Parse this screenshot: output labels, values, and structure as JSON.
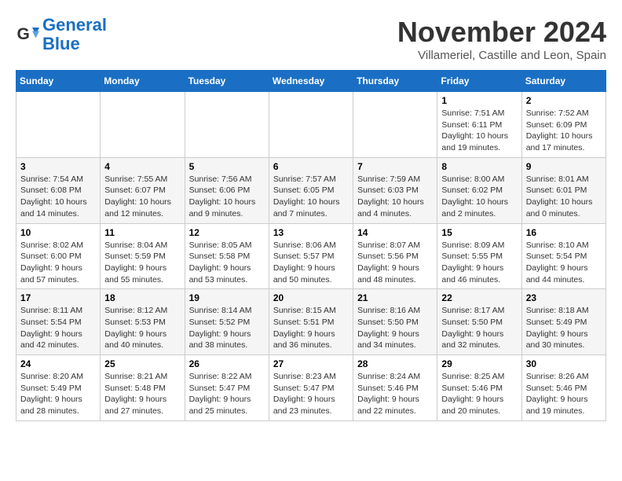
{
  "logo": {
    "line1": "General",
    "line2": "Blue"
  },
  "title": "November 2024",
  "location": "Villameriel, Castille and Leon, Spain",
  "weekdays": [
    "Sunday",
    "Monday",
    "Tuesday",
    "Wednesday",
    "Thursday",
    "Friday",
    "Saturday"
  ],
  "weeks": [
    [
      {
        "day": "",
        "info": ""
      },
      {
        "day": "",
        "info": ""
      },
      {
        "day": "",
        "info": ""
      },
      {
        "day": "",
        "info": ""
      },
      {
        "day": "",
        "info": ""
      },
      {
        "day": "1",
        "info": "Sunrise: 7:51 AM\nSunset: 6:11 PM\nDaylight: 10 hours and 19 minutes."
      },
      {
        "day": "2",
        "info": "Sunrise: 7:52 AM\nSunset: 6:09 PM\nDaylight: 10 hours and 17 minutes."
      }
    ],
    [
      {
        "day": "3",
        "info": "Sunrise: 7:54 AM\nSunset: 6:08 PM\nDaylight: 10 hours and 14 minutes."
      },
      {
        "day": "4",
        "info": "Sunrise: 7:55 AM\nSunset: 6:07 PM\nDaylight: 10 hours and 12 minutes."
      },
      {
        "day": "5",
        "info": "Sunrise: 7:56 AM\nSunset: 6:06 PM\nDaylight: 10 hours and 9 minutes."
      },
      {
        "day": "6",
        "info": "Sunrise: 7:57 AM\nSunset: 6:05 PM\nDaylight: 10 hours and 7 minutes."
      },
      {
        "day": "7",
        "info": "Sunrise: 7:59 AM\nSunset: 6:03 PM\nDaylight: 10 hours and 4 minutes."
      },
      {
        "day": "8",
        "info": "Sunrise: 8:00 AM\nSunset: 6:02 PM\nDaylight: 10 hours and 2 minutes."
      },
      {
        "day": "9",
        "info": "Sunrise: 8:01 AM\nSunset: 6:01 PM\nDaylight: 10 hours and 0 minutes."
      }
    ],
    [
      {
        "day": "10",
        "info": "Sunrise: 8:02 AM\nSunset: 6:00 PM\nDaylight: 9 hours and 57 minutes."
      },
      {
        "day": "11",
        "info": "Sunrise: 8:04 AM\nSunset: 5:59 PM\nDaylight: 9 hours and 55 minutes."
      },
      {
        "day": "12",
        "info": "Sunrise: 8:05 AM\nSunset: 5:58 PM\nDaylight: 9 hours and 53 minutes."
      },
      {
        "day": "13",
        "info": "Sunrise: 8:06 AM\nSunset: 5:57 PM\nDaylight: 9 hours and 50 minutes."
      },
      {
        "day": "14",
        "info": "Sunrise: 8:07 AM\nSunset: 5:56 PM\nDaylight: 9 hours and 48 minutes."
      },
      {
        "day": "15",
        "info": "Sunrise: 8:09 AM\nSunset: 5:55 PM\nDaylight: 9 hours and 46 minutes."
      },
      {
        "day": "16",
        "info": "Sunrise: 8:10 AM\nSunset: 5:54 PM\nDaylight: 9 hours and 44 minutes."
      }
    ],
    [
      {
        "day": "17",
        "info": "Sunrise: 8:11 AM\nSunset: 5:54 PM\nDaylight: 9 hours and 42 minutes."
      },
      {
        "day": "18",
        "info": "Sunrise: 8:12 AM\nSunset: 5:53 PM\nDaylight: 9 hours and 40 minutes."
      },
      {
        "day": "19",
        "info": "Sunrise: 8:14 AM\nSunset: 5:52 PM\nDaylight: 9 hours and 38 minutes."
      },
      {
        "day": "20",
        "info": "Sunrise: 8:15 AM\nSunset: 5:51 PM\nDaylight: 9 hours and 36 minutes."
      },
      {
        "day": "21",
        "info": "Sunrise: 8:16 AM\nSunset: 5:50 PM\nDaylight: 9 hours and 34 minutes."
      },
      {
        "day": "22",
        "info": "Sunrise: 8:17 AM\nSunset: 5:50 PM\nDaylight: 9 hours and 32 minutes."
      },
      {
        "day": "23",
        "info": "Sunrise: 8:18 AM\nSunset: 5:49 PM\nDaylight: 9 hours and 30 minutes."
      }
    ],
    [
      {
        "day": "24",
        "info": "Sunrise: 8:20 AM\nSunset: 5:49 PM\nDaylight: 9 hours and 28 minutes."
      },
      {
        "day": "25",
        "info": "Sunrise: 8:21 AM\nSunset: 5:48 PM\nDaylight: 9 hours and 27 minutes."
      },
      {
        "day": "26",
        "info": "Sunrise: 8:22 AM\nSunset: 5:47 PM\nDaylight: 9 hours and 25 minutes."
      },
      {
        "day": "27",
        "info": "Sunrise: 8:23 AM\nSunset: 5:47 PM\nDaylight: 9 hours and 23 minutes."
      },
      {
        "day": "28",
        "info": "Sunrise: 8:24 AM\nSunset: 5:46 PM\nDaylight: 9 hours and 22 minutes."
      },
      {
        "day": "29",
        "info": "Sunrise: 8:25 AM\nSunset: 5:46 PM\nDaylight: 9 hours and 20 minutes."
      },
      {
        "day": "30",
        "info": "Sunrise: 8:26 AM\nSunset: 5:46 PM\nDaylight: 9 hours and 19 minutes."
      }
    ]
  ]
}
